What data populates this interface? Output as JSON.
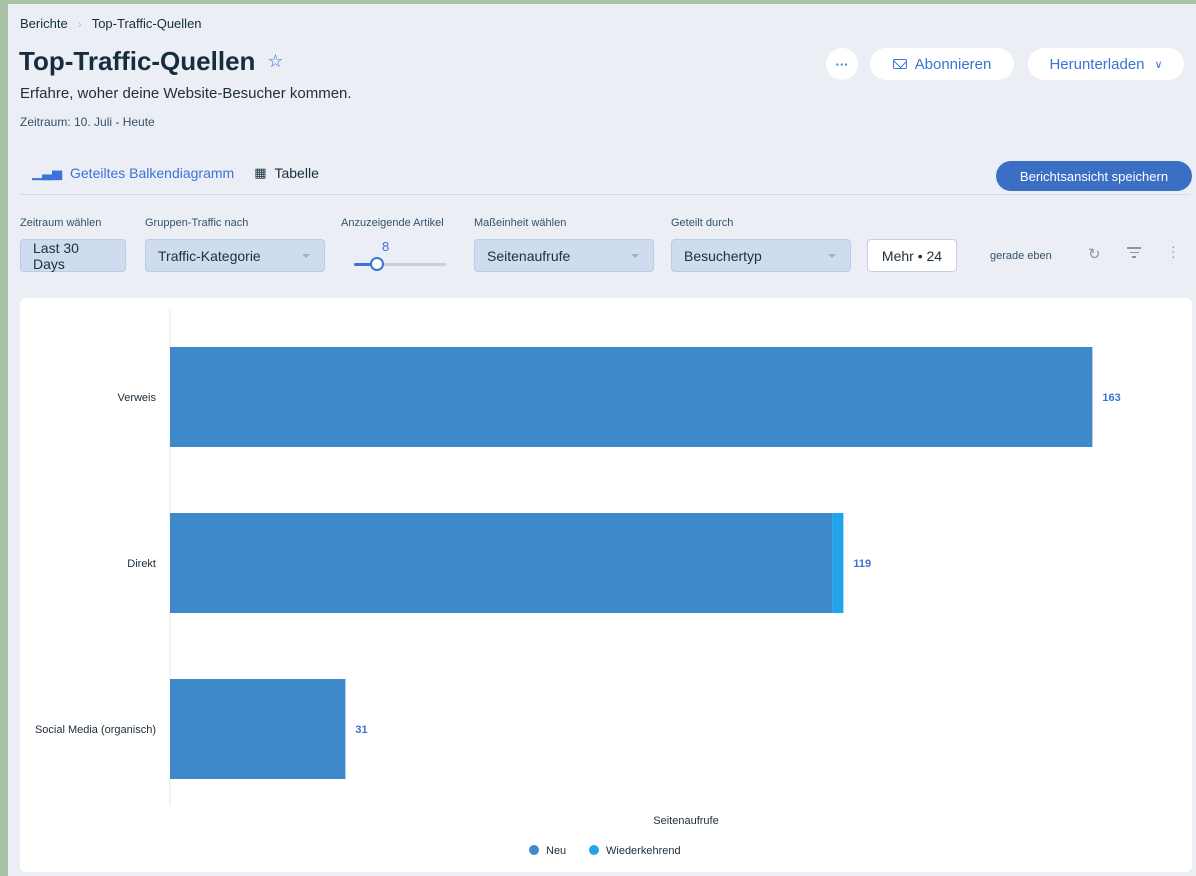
{
  "breadcrumb": {
    "root": "Berichte",
    "current": "Top-Traffic-Quellen"
  },
  "header": {
    "title": "Top-Traffic-Quellen",
    "subtitle": "Erfahre, woher deine Website-Besucher kommen.",
    "period": "Zeitraum: 10. Juli - Heute",
    "more_label": "···",
    "subscribe_label": "Abonnieren",
    "download_label": "Herunterladen"
  },
  "tabs": [
    {
      "label": "Geteiltes Balkendiagramm",
      "icon": "bar-chart-icon",
      "active": true
    },
    {
      "label": "Tabelle",
      "icon": "table-icon",
      "active": false
    }
  ],
  "save_view_label": "Berichtsansicht speichern",
  "filters": {
    "period": {
      "label": "Zeitraum wählen",
      "value": "Last 30 Days"
    },
    "group": {
      "label": "Gruppen-Traffic nach",
      "value": "Traffic-Kategorie"
    },
    "items": {
      "label": "Anzuzeigende Artikel",
      "value": "8",
      "level": 0.25
    },
    "metric": {
      "label": "Maßeinheit wählen",
      "value": "Seitenaufrufe"
    },
    "split": {
      "label": "Geteilt durch",
      "value": "Besuchertyp"
    },
    "more": "Mehr • 24",
    "updated": "gerade eben"
  },
  "colors": {
    "accent": "#3b73d6",
    "neu": "#3f88c9",
    "wiederkehrend": "#23a4ea"
  },
  "chart_data": {
    "type": "bar",
    "orientation": "horizontal",
    "stacked": true,
    "categories": [
      "Verweis",
      "Direkt",
      "Social Media (organisch)"
    ],
    "series": [
      {
        "name": "Neu",
        "values": [
          163,
          117,
          31
        ]
      },
      {
        "name": "Wiederkehrend",
        "values": [
          0,
          2,
          0
        ]
      }
    ],
    "totals": [
      "163",
      "119",
      "31"
    ],
    "xlabel": "Seitenaufrufe",
    "xlim": [
      0,
      170
    ],
    "legend": "bottom-center",
    "grid": false
  }
}
